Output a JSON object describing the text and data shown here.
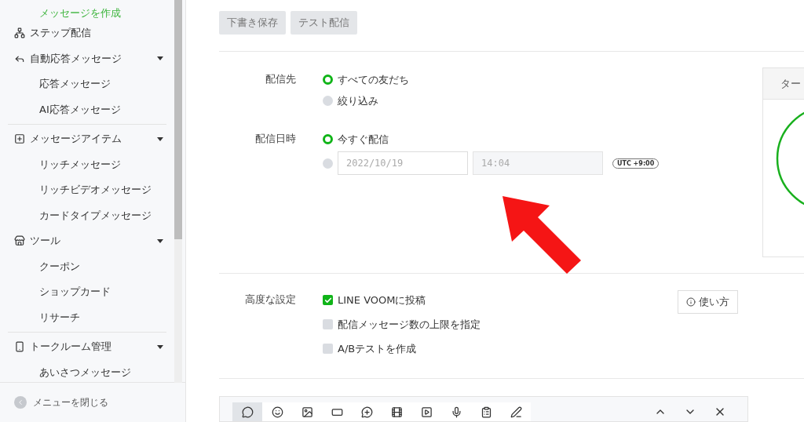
{
  "sidebar": {
    "groups": [
      {
        "items": [
          {
            "kind": "sub",
            "label": "メッセージを作成",
            "selected": true
          },
          {
            "kind": "link",
            "label": "ステップ配信",
            "selected": false
          },
          {
            "kind": "section",
            "label": "自動応答メッセージ",
            "expanded": true,
            "children": [
              {
                "label": "応答メッセージ",
                "selected": false
              },
              {
                "label": "AI応答メッセージ",
                "selected": false
              }
            ]
          }
        ]
      },
      {
        "items": [
          {
            "kind": "section",
            "label": "メッセージアイテム",
            "expanded": true,
            "children": [
              {
                "label": "リッチメッセージ",
                "selected": false
              },
              {
                "label": "リッチビデオメッセージ",
                "selected": false
              },
              {
                "label": "カードタイプメッセージ",
                "selected": false
              }
            ]
          },
          {
            "kind": "section",
            "label": "ツール",
            "expanded": true,
            "children": [
              {
                "label": "クーポン",
                "selected": false
              },
              {
                "label": "ショップカード",
                "selected": false
              },
              {
                "label": "リサーチ",
                "selected": false
              }
            ]
          }
        ]
      },
      {
        "items": [
          {
            "kind": "section",
            "label": "トークルーム管理",
            "expanded": true,
            "children": [
              {
                "label": "あいさつメッセージ",
                "selected": false
              }
            ]
          }
        ]
      }
    ],
    "close_menu": "メニューを閉じる"
  },
  "buttons": [
    "下書き保存",
    "テスト配信"
  ],
  "recipients": {
    "label": "配信先",
    "options": [
      {
        "label": "すべての友だち",
        "selected": true
      },
      {
        "label": "絞り込み",
        "selected": false
      }
    ]
  },
  "schedule": {
    "label": "配信日時",
    "options": [
      {
        "label": "今すぐ配信",
        "selected": true
      },
      {
        "selected": false,
        "date": "2022/10/19",
        "time": "14:04"
      }
    ],
    "timezone": "UTC +9:00"
  },
  "preview": {
    "tab": "ター"
  },
  "advanced": {
    "label": "高度な設定",
    "options": [
      {
        "label": "LINE VOOMに投稿",
        "checked": true
      },
      {
        "label": "配信メッセージ数の上限を指定",
        "checked": false
      },
      {
        "label": "A/Bテストを作成",
        "checked": false
      }
    ],
    "help": "使い方"
  },
  "toolbar": {
    "tools": [
      {
        "selected": true
      },
      {
        "selected": false
      },
      {
        "selected": false
      },
      {
        "selected": false
      },
      {
        "selected": false
      },
      {
        "selected": false
      },
      {
        "selected": false
      },
      {
        "selected": false
      },
      {
        "selected": false
      },
      {
        "selected": false
      }
    ]
  }
}
